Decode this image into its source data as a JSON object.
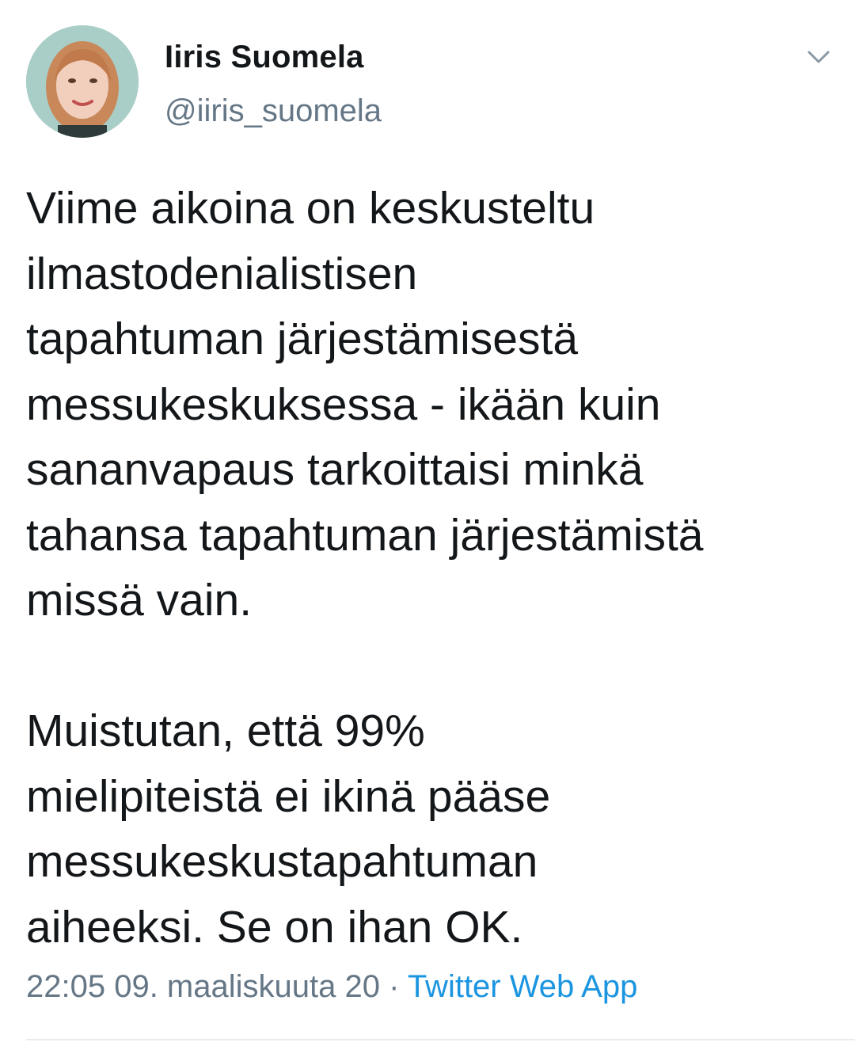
{
  "tweet": {
    "author": {
      "display_name": "Iiris Suomela",
      "handle": "@iiris_suomela",
      "avatar": "profile-photo"
    },
    "menu_icon": "chevron-down-icon",
    "text": "Viime aikoina on keskusteltu\nilmastodenialistisen\ntapahtuman järjestämisestä\nmessukeskuksessa - ikään kuin\nsananvapaus tarkoittaisi minkä\ntahansa tapahtuman järjestämistä\nmissä vain.\n\nMuistutan, että 99%\nmielipiteistä ei ikinä pääse\nmessukeskustapahtuman\naiheeksi. Se on ihan OK.",
    "timestamp": "22:05 09. maaliskuuta 20",
    "separator": "·",
    "source": "Twitter Web App"
  },
  "colors": {
    "text": "#14171a",
    "secondary": "#657786",
    "link": "#1b95e0",
    "divider": "#e6ecf0"
  }
}
